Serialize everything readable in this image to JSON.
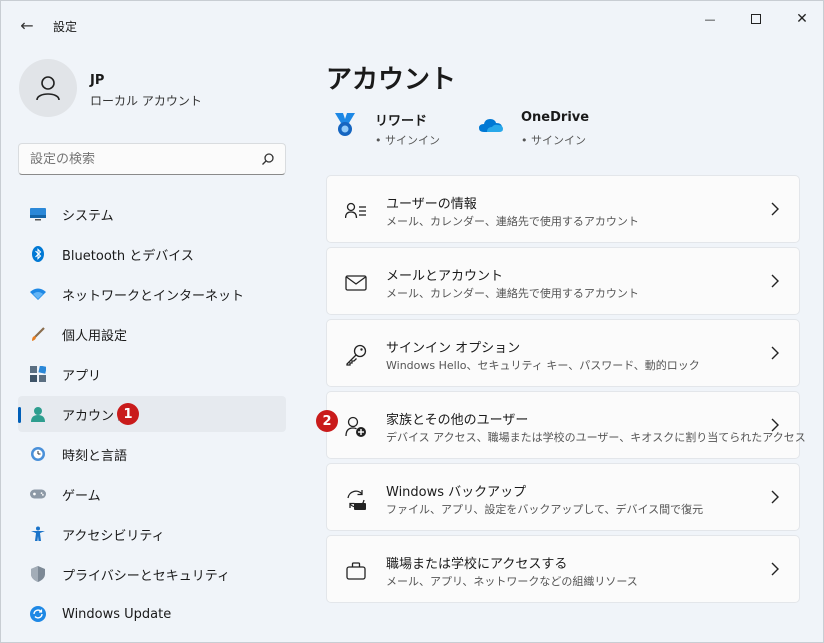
{
  "titlebar": {
    "title": "設定",
    "back_glyph": "←",
    "minimize_glyph": "—",
    "close_glyph": "✕"
  },
  "profile": {
    "name": "JP",
    "account_type": "ローカル アカウント"
  },
  "search": {
    "placeholder": "設定の検索"
  },
  "sidebar": {
    "items": [
      {
        "label": "システム",
        "icon": "system-icon"
      },
      {
        "label": "Bluetooth とデバイス",
        "icon": "bluetooth-icon"
      },
      {
        "label": "ネットワークとインターネット",
        "icon": "wifi-icon"
      },
      {
        "label": "個人用設定",
        "icon": "brush-icon"
      },
      {
        "label": "アプリ",
        "icon": "apps-icon"
      },
      {
        "label": "アカウント",
        "icon": "account-icon",
        "active": true
      },
      {
        "label": "時刻と言語",
        "icon": "clock-globe-icon"
      },
      {
        "label": "ゲーム",
        "icon": "gamepad-icon"
      },
      {
        "label": "アクセシビリティ",
        "icon": "accessibility-icon"
      },
      {
        "label": "プライバシーとセキュリティ",
        "icon": "shield-icon"
      },
      {
        "label": "Windows Update",
        "icon": "update-icon"
      }
    ]
  },
  "annotations": {
    "step1": "1",
    "step2": "2"
  },
  "main": {
    "title": "アカウント",
    "quick": [
      {
        "title": "リワード",
        "subtitle": "• サインイン",
        "icon": "rewards-icon"
      },
      {
        "title": "OneDrive",
        "subtitle": "• サインイン",
        "icon": "onedrive-icon"
      }
    ],
    "cards": [
      {
        "title": "ユーザーの情報",
        "subtitle": "メール、カレンダー、連絡先で使用するアカウント",
        "icon": "user-info-icon"
      },
      {
        "title": "メールとアカウント",
        "subtitle": "メール、カレンダー、連絡先で使用するアカウント",
        "icon": "mail-icon"
      },
      {
        "title": "サインイン オプション",
        "subtitle": "Windows Hello、セキュリティ キー、パスワード、動的ロック",
        "icon": "key-icon"
      },
      {
        "title": "家族とその他のユーザー",
        "subtitle": "デバイス アクセス、職場または学校のユーザー、キオスクに割り当てられたアクセス",
        "icon": "add-person-icon"
      },
      {
        "title": "Windows バックアップ",
        "subtitle": "ファイル、アプリ、設定をバックアップして、デバイス間で復元",
        "icon": "backup-icon"
      },
      {
        "title": "職場または学校にアクセスする",
        "subtitle": "メール、アプリ、ネットワークなどの組織リソース",
        "icon": "briefcase-icon"
      }
    ]
  },
  "colors": {
    "accent": "#005fb8",
    "badge": "#c91b1b",
    "window_bg": "#f0f4f9",
    "card_bg": "#fbfbfb"
  }
}
